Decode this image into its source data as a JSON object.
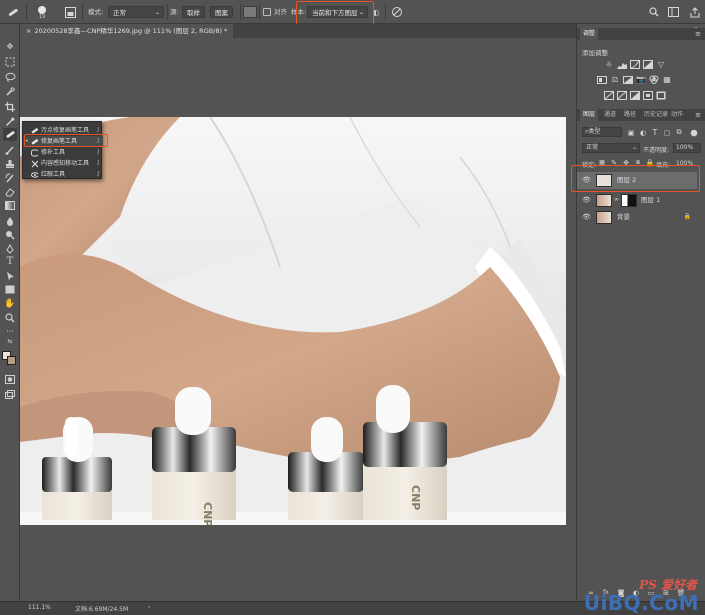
{
  "options_bar": {
    "brush_size": "19",
    "mode_label": "模式:",
    "mode_value": "正常",
    "source_label": "源:",
    "source_sample": "取样",
    "source_pattern": "图案",
    "aligned_label": "对齐",
    "sample_label": "样本:",
    "sample_value": "当前和下方图层"
  },
  "document": {
    "tab_title": "20200528李鑫—CNP精华1269.jpg @ 111% (图层 2, RGB/8) *"
  },
  "flyout": {
    "items": [
      {
        "icon": "spot-healing-brush-icon",
        "label": "污点修复画笔工具",
        "key": "J"
      },
      {
        "icon": "healing-brush-icon",
        "label": "修复画笔工具",
        "key": "J",
        "selected": true
      },
      {
        "icon": "patch-icon",
        "label": "修补工具",
        "key": "J"
      },
      {
        "icon": "content-aware-move-icon",
        "label": "内容感知移动工具",
        "key": "J"
      },
      {
        "icon": "red-eye-icon",
        "label": "红眼工具",
        "key": "J"
      }
    ]
  },
  "adjustments_panel": {
    "tab": "调整",
    "header": "添加调整"
  },
  "layers_panel": {
    "tabs": [
      "图层",
      "通道",
      "路径",
      "历史记录",
      "动作"
    ],
    "filter_kind": "类型",
    "blend_mode": "正常",
    "opacity_label": "不透明度:",
    "opacity_value": "100%",
    "lock_label": "锁定:",
    "fill_label": "填充:",
    "fill_value": "100%",
    "layers": [
      {
        "name": "图层 2",
        "selected": true
      },
      {
        "name": "图层 1",
        "selected": false,
        "has_mask": true
      },
      {
        "name": "背景",
        "selected": false,
        "locked": true
      }
    ]
  },
  "status_bar": {
    "zoom": "111.1%",
    "doc_info": "文档:6.69M/24.5M"
  },
  "watermark": {
    "text": "UiBQ.CoM",
    "subtext": "PS 爱好者"
  },
  "colors": {
    "accent_highlight": "#e8512a",
    "panel_bg": "#535353",
    "dark_bg": "#424242"
  }
}
